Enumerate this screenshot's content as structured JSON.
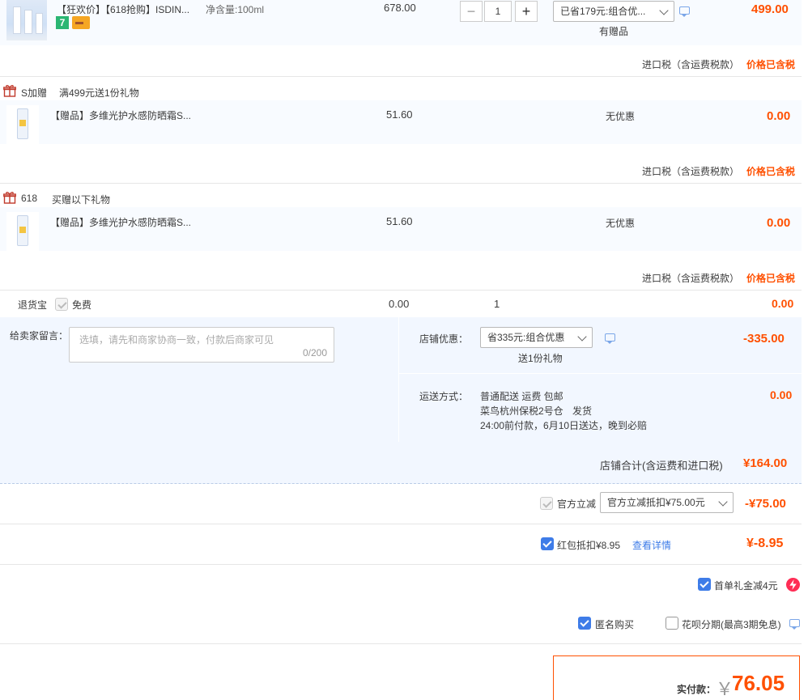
{
  "product": {
    "tags": "【狂欢价】【618抢购】ISDIN...",
    "spec": "净含量:100ml",
    "unit_price": "678.00",
    "quantity": "1",
    "promo_select": "已省179元:组合优...",
    "gift_note": "有赠品",
    "total": "499.00",
    "import_tax": "进口税（含运费税款）",
    "tax_status": "价格已含税",
    "badge_seven": "7"
  },
  "gift_groups": [
    {
      "title": "S加赠",
      "subtitle": "满499元送1份礼物",
      "item_name": "【赠品】多维光护水感防晒霜S...",
      "price": "51.60",
      "discount": "无优惠",
      "total": "0.00",
      "import_tax": "进口税（含运费税款）",
      "tax_status": "价格已含税"
    },
    {
      "title": "618",
      "subtitle": "买赠以下礼物",
      "item_name": "【赠品】多维光护水感防晒霜S...",
      "price": "51.60",
      "discount": "无优惠",
      "total": "0.00",
      "import_tax": "进口税（含运费税款）",
      "tax_status": "价格已含税"
    }
  ],
  "return_insurance": {
    "label": "退货宝",
    "free": "免费",
    "price": "0.00",
    "qty": "1",
    "total": "0.00"
  },
  "message": {
    "label": "给卖家留言：",
    "placeholder": "选填，请先和商家协商一致，付款后商家可见",
    "counter": "0/200"
  },
  "shop_discount": {
    "label": "店铺优惠：",
    "select": "省335元:组合优惠",
    "note": "送1份礼物",
    "amount": "-335.00"
  },
  "shipping": {
    "label": "运送方式：",
    "line1": "普通配送 运费 包邮",
    "line2a": "菜鸟杭州保税2号仓",
    "line2b": "发货",
    "line3": "24:00前付款，6月10日送达，晚到必赔",
    "amount": "0.00"
  },
  "shop_total": {
    "label": "店铺合计(含运费和进口税)",
    "amount": "¥164.00"
  },
  "official_discount": {
    "label": "官方立减",
    "select": "官方立减抵扣¥75.00元",
    "amount": "-¥75.00"
  },
  "red_packet": {
    "label": "红包抵扣¥8.95",
    "link": "查看详情",
    "amount": "¥-8.95"
  },
  "first_order": {
    "label": "首单礼金减4元"
  },
  "anonymous": {
    "label": "匿名购买"
  },
  "huabei": {
    "label": "花呗分期(最高3期免息)"
  },
  "payment": {
    "label": "实付款：",
    "currency": "￥",
    "amount": "76.05"
  },
  "colors": {
    "accent": "#ff5000",
    "checkbox": "#3e7ce8",
    "link": "#3e7ce8"
  }
}
